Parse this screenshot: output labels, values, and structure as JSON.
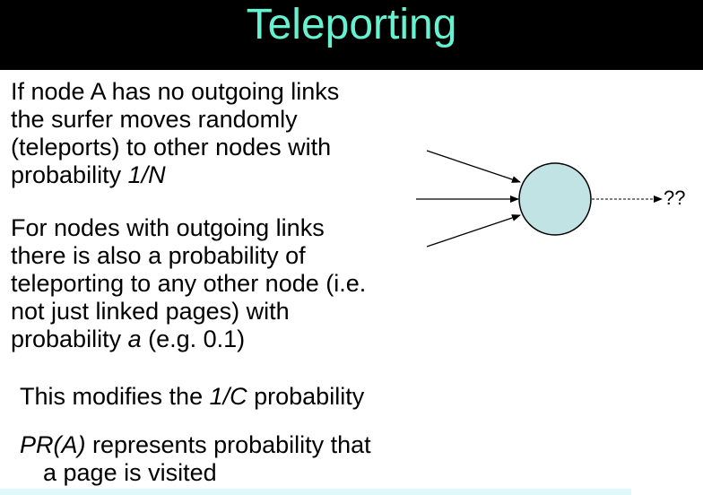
{
  "slide": {
    "title": "Teleporting"
  },
  "paragraph1": {
    "line1": "If node A has no outgoing links",
    "line2": "the surfer moves randomly",
    "line3": "(teleports) to other nodes with",
    "line4_prefix": "probability ",
    "line4_italic": "1/N"
  },
  "paragraph2": {
    "line1": "For nodes with outgoing links",
    "line2": "there is also a probability of",
    "line3": "teleporting to any other node (i.e.",
    "line4": "not just linked pages) with",
    "line5_prefix": "probability ",
    "line5_italic": "a",
    "line5_suffix": " (e.g. 0.1)"
  },
  "paragraph3": {
    "prefix": "This modifies the ",
    "italic": "1/C",
    "suffix": " probability"
  },
  "paragraph4": {
    "italic": "PR(A)",
    "line1_suffix": " represents probability that",
    "line2": "a page is visited"
  },
  "diagram": {
    "node_color": "#c1e3e3",
    "outgoing_label": "??"
  }
}
